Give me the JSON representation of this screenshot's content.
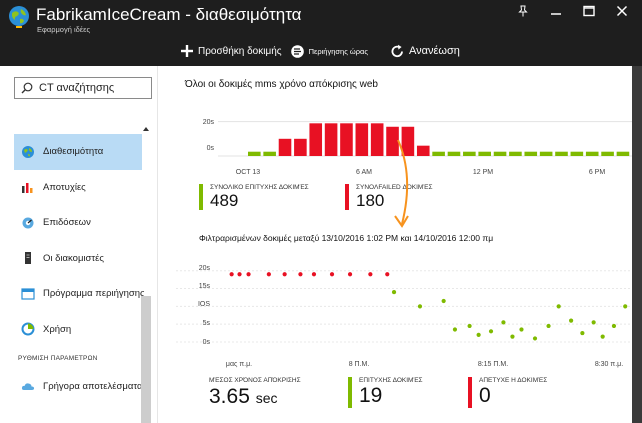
{
  "window": {
    "title": "FabrikamIceCream - διαθεσιμότητα",
    "subtitle": "Εφαρμογή ιδέες",
    "colors": {
      "titlebar": "#1e1e1e",
      "accent_pass": "#7fba00",
      "accent_fail": "#e81123",
      "selected": "#b9dbf5",
      "annotation": "#f7931e"
    }
  },
  "toolbar": {
    "add_label": "Προσθήκη δοκιμής",
    "browse_label": "Περιήγησης ώρας",
    "refresh_label": "Ανανέωση"
  },
  "sidebar": {
    "search_placeholder": "CT αναζήτησης",
    "items": [
      {
        "label": "Διαθεσιμότητα",
        "icon": "globe-icon",
        "active": true
      },
      {
        "label": "Αποτυχίες",
        "icon": "bar-chart-icon",
        "active": false
      },
      {
        "label": "Επιδόσεων",
        "icon": "performance-icon",
        "active": false
      },
      {
        "label": "Οι διακομιστές",
        "icon": "server-icon",
        "active": false
      },
      {
        "label": "Πρόγραμμα περιήγησης",
        "icon": "browser-icon",
        "active": false
      },
      {
        "label": "Χρήση",
        "icon": "usage-icon",
        "active": false
      }
    ],
    "section_label": "ΡΥΘΜΙΣΗ ΠΑΡΑΜΕΤΡΩΝ",
    "section_items": [
      {
        "label": "Γρήγορα αποτελέσματα",
        "icon": "cloud-icon"
      }
    ]
  },
  "summary_chart": {
    "title": "Όλοι οι δοκιμές mms χρόνο απόκρισης web",
    "y_ticks": [
      "20s",
      "0s"
    ],
    "x_ticks": [
      "OCT 13",
      "6 AM",
      "12 PM",
      "6 PM"
    ]
  },
  "summary_stats": {
    "passed_label": "ΣΥΝΟΛΙΚΟ ΕΠΙΤΥΧΗΣ ΔΟΚΙΜΈΣ",
    "passed_value": "489",
    "failed_label": "ΣΥΝΟΛFAILED ΔΟΚΙΜΈΣ",
    "failed_value": "180"
  },
  "detail_chart": {
    "title": "Φιλτραρισμένων δοκιμές μεταξύ 13/10/2016 1:02 PM και 14/10/2016 12:00 πμ",
    "y_ticks": [
      "20s",
      "15s",
      "IOS",
      "5s",
      "0s"
    ],
    "x_ticks": [
      "μας π.μ.",
      "8 Π.Μ.",
      "8:15 Π.Μ.",
      "8:30 π.μ."
    ]
  },
  "detail_stats": {
    "avg_label": "ΜΈΣΟΣ ΧΡΌΝΟΣ ΑΠΌΚΡΙΣΗΣ",
    "avg_value": "3.65",
    "avg_unit": "sec",
    "passed_label": "ΕΠΙΤΥΧΗΣ ΔΟΚΙΜΈΣ",
    "passed_value": "19",
    "failed_label": "ΑΠΕΤΥΧΕ Η ΔΟΚΙΜΈΣ",
    "failed_value": "0"
  },
  "chart_data": [
    {
      "type": "bar",
      "title": "Όλοι οι δοκιμές mms χρόνο απόκρισης web",
      "ylim": [
        0,
        25
      ],
      "grid": true,
      "legend": "none",
      "series": [
        {
          "color": "#7fba00",
          "values": [
            2.5,
            2.5,
            0,
            0,
            0,
            0,
            0,
            0,
            0,
            0,
            0,
            0,
            2.5,
            2.5,
            2.5,
            2.5,
            2.5,
            2.5,
            2.5,
            2.5,
            2.5,
            2.5,
            2.5,
            2.5,
            2.5
          ]
        },
        {
          "color": "#e81123",
          "values": [
            0,
            0,
            10,
            10,
            19,
            19,
            19,
            19,
            19,
            17,
            17,
            6,
            0,
            0,
            0,
            0,
            0,
            0,
            0,
            0,
            0,
            0,
            0,
            0,
            0
          ]
        }
      ]
    },
    {
      "type": "scatter",
      "title": "Φιλτραρισμένων δοκιμές μεταξύ 13/10/2016 1:02 PM και 14/10/2016 12:00 πμ",
      "ylim": [
        0,
        23
      ],
      "grid": true,
      "legend": "none",
      "series": [
        {
          "color": "#e81123",
          "points": [
            [
              0.5,
              19
            ],
            [
              1.2,
              19
            ],
            [
              2.0,
              19
            ],
            [
              3.8,
              19
            ],
            [
              5.2,
              19
            ],
            [
              6.6,
              19
            ],
            [
              7.8,
              19
            ],
            [
              9.4,
              19
            ],
            [
              11.0,
              19
            ],
            [
              12.8,
              19
            ],
            [
              14.3,
              19
            ]
          ]
        },
        {
          "color": "#7fba00",
          "points": [
            [
              14.9,
              14
            ],
            [
              17.2,
              10
            ],
            [
              19.3,
              11.5
            ],
            [
              20.3,
              3.5
            ],
            [
              21.6,
              4.5
            ],
            [
              22.4,
              2
            ],
            [
              23.5,
              3
            ],
            [
              24.6,
              5.5
            ],
            [
              25.4,
              1.5
            ],
            [
              26.2,
              3.5
            ],
            [
              27.4,
              1
            ],
            [
              28.6,
              4.5
            ],
            [
              29.5,
              10
            ],
            [
              30.6,
              6
            ],
            [
              31.6,
              2.5
            ],
            [
              32.6,
              5.5
            ],
            [
              33.4,
              1.5
            ],
            [
              34.4,
              4.5
            ],
            [
              35.4,
              10
            ]
          ]
        }
      ],
      "x_range": [
        0,
        36
      ]
    }
  ]
}
